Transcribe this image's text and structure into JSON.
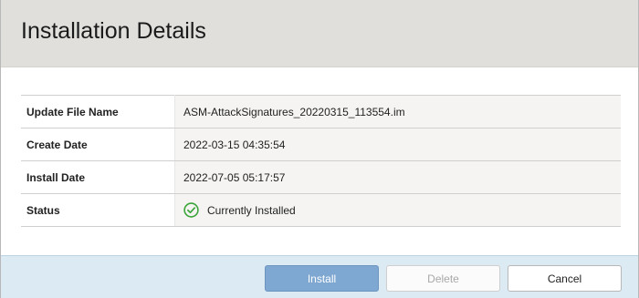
{
  "dialog": {
    "title": "Installation Details"
  },
  "details": {
    "rows": [
      {
        "label": "Update File Name",
        "value": "ASM-AttackSignatures_20220315_113554.im"
      },
      {
        "label": "Create Date",
        "value": "2022-03-15 04:35:54"
      },
      {
        "label": "Install Date",
        "value": "2022-07-05 05:17:57"
      },
      {
        "label": "Status",
        "value": "Currently Installed",
        "icon": "check-circle-icon"
      }
    ]
  },
  "footer": {
    "install_label": "Install",
    "delete_label": "Delete",
    "cancel_label": "Cancel"
  },
  "colors": {
    "header_bg": "#e0dfdc",
    "footer_bg": "#dbeaf3",
    "install_bg": "#7ea7d1",
    "status_green": "#3aa53a"
  }
}
